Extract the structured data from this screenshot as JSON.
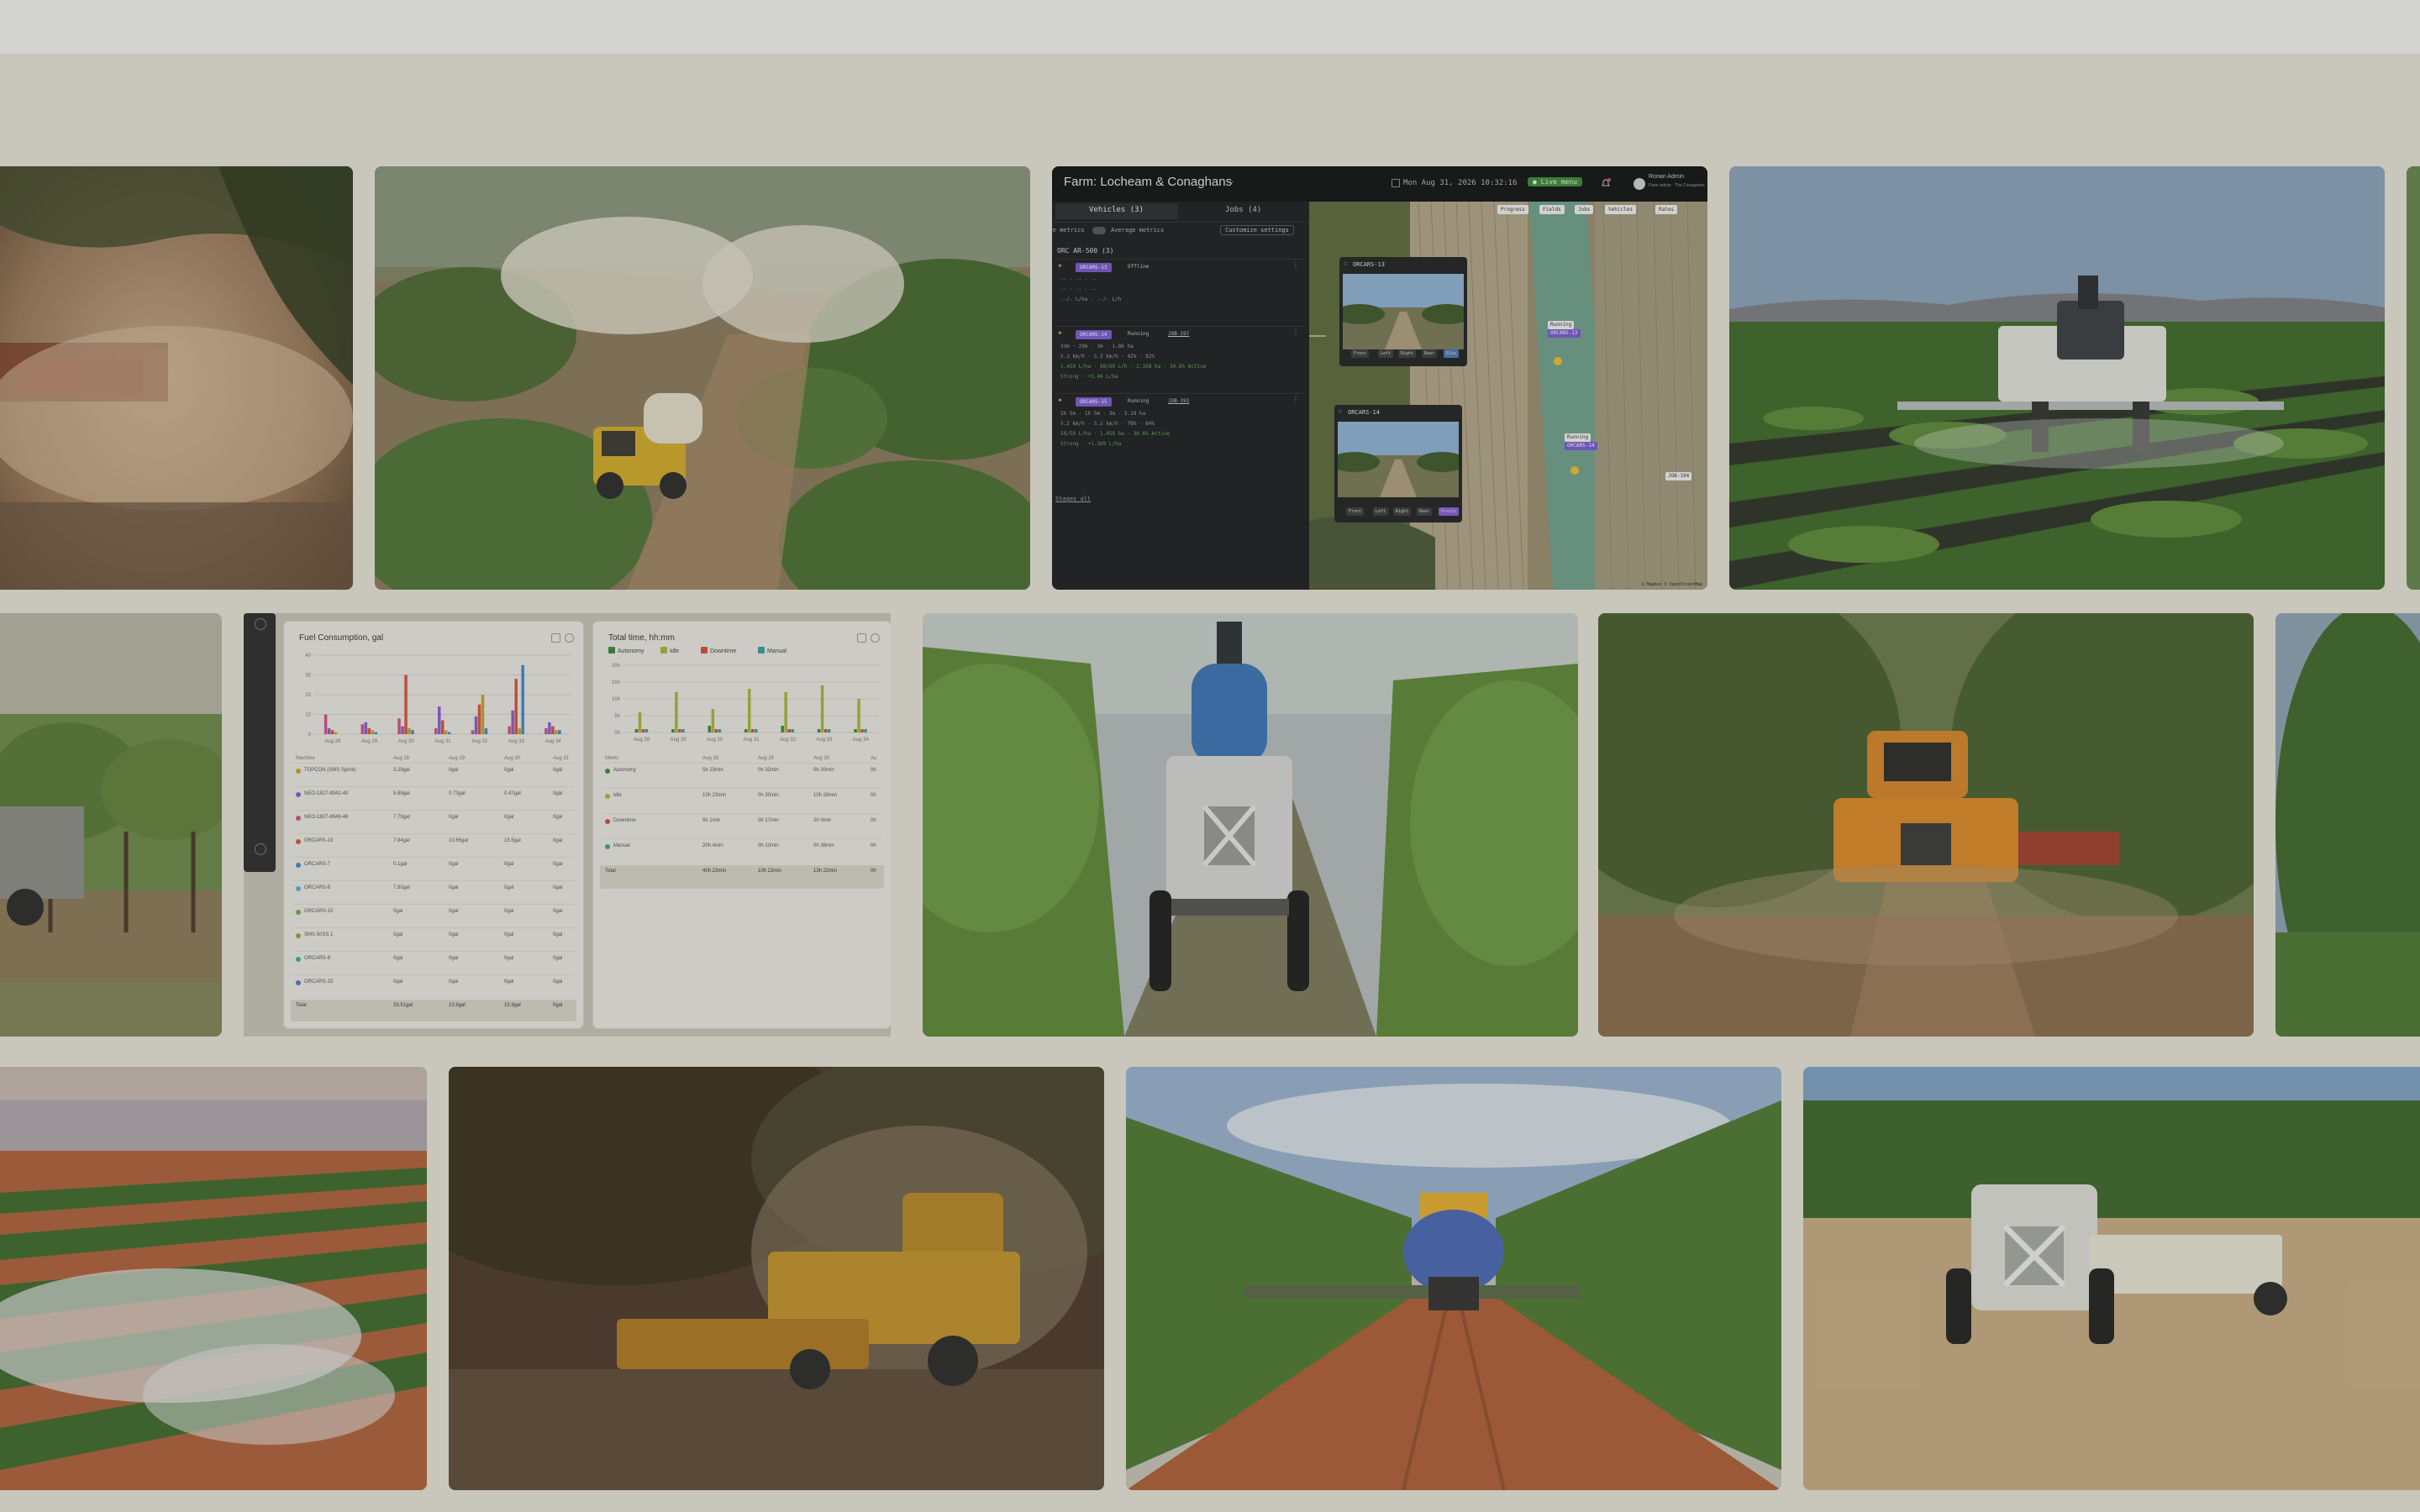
{
  "dashboard": {
    "farm_title": "Farm: Locheam & Conaghans",
    "datetime": "Mon Aug 31, 2026 10:32:16",
    "live_label": "● Live menu",
    "user_name": "Ronan Admin",
    "user_sub": "Farm admin · The Conaghans",
    "tabs": [
      "Vehicles (3)",
      "Jobs (4)"
    ],
    "live_metrics_label": "Live metrics",
    "average_metrics_label": "Average metrics",
    "customize_label": "Customize settings",
    "group_label": "ORC AR-500 (3)",
    "vehicles": [
      {
        "id": "ORCARS-13",
        "status": "Offline",
        "job": "",
        "l1": "-- · -- · --",
        "l2": "-- · -- · --",
        "l3": "--/- L/ha · --/- L/h",
        "l4": ""
      },
      {
        "id": "ORCARS-14",
        "status": "Running",
        "job": "JOB-197",
        "l1": "33m · 29m · 3m · 1.86 ha",
        "l2": "5.3 km/h · 5.3 km/h · 42% · 82%",
        "l3": "1.450 L/ha · 68/60 L/h · 2.358 ha · 30.6% Active",
        "l4": "Strong · +3.46 L/ha"
      },
      {
        "id": "ORCARS-15",
        "status": "Running",
        "job": "JOB-193",
        "l1": "1h 5m · 1h 5m · 3m · 3.19 ha",
        "l2": "5.2 km/h · 5.2 km/h · 78% · 84%",
        "l3": "58/58 L/ha · 1.459 ha · 30.6% Active",
        "l4": "Strong · +1.369 L/ha"
      }
    ],
    "link_label": "Stages all",
    "map_pills": [
      "Progress",
      "Fields",
      "Jobs",
      "Vehicles",
      "Rates"
    ],
    "cams": [
      {
        "title": "ORCARS-13",
        "buttons": [
          "Front",
          "Left",
          "Right",
          "Rear",
          "Blue"
        ]
      },
      {
        "title": "ORCARS-14",
        "buttons": [
          "Front",
          "Left",
          "Right",
          "Rear",
          "Purple"
        ]
      }
    ],
    "map_tags": [
      "Running",
      "ORCARS-13",
      "Running",
      "ORCARS-14",
      "JOB-194"
    ],
    "map_credit": "© Mapbox © OpenStreetMap"
  },
  "reports": {
    "fuel": {
      "title": "Fuel Consumption, gal",
      "y_ticks": [
        "40",
        "30",
        "20",
        "10",
        "0"
      ],
      "x_ticks": [
        "Aug 28",
        "Aug 29",
        "Aug 30",
        "Aug 31",
        "Aug 32",
        "Aug 33",
        "Aug 34"
      ],
      "columns": [
        "Machine",
        "Aug 28",
        "Aug 29",
        "Aug 30",
        "Aug 31"
      ],
      "rows": [
        {
          "name": "TOPCON (SMS Sprint)",
          "cells": [
            "3.29gal",
            "0gal",
            "0gal",
            "0gal"
          ],
          "color": "#c9a227"
        },
        {
          "name": "NEO-1827-8942-40",
          "cells": [
            "5.89gal",
            "0.73gal",
            "0.47gal",
            "0gal"
          ],
          "color": "#8a5bd6"
        },
        {
          "name": "NEO-1827-8949-46",
          "cells": [
            "7.79gal",
            "0gal",
            "0gal",
            "0gal"
          ],
          "color": "#d64f8a"
        },
        {
          "name": "ORCARS-13",
          "cells": [
            "7.84gal",
            "10.65gal",
            "15.5gal",
            "0gal"
          ],
          "color": "#d6553c"
        },
        {
          "name": "ORCARS-7",
          "cells": [
            "0.1gal",
            "0gal",
            "0gal",
            "0gal"
          ],
          "color": "#3c8ad6"
        },
        {
          "name": "ORCARS-9",
          "cells": [
            "7.80gal",
            "0gal",
            "0gal",
            "0gal"
          ],
          "color": "#5bb0d6"
        },
        {
          "name": "ORCARS-10",
          "cells": [
            "0gal",
            "0gal",
            "0gal",
            "0gal"
          ],
          "color": "#6fb04a"
        },
        {
          "name": "SMS 50SS 1",
          "cells": [
            "0gal",
            "0gal",
            "0gal",
            "0gal"
          ],
          "color": "#a0a03c"
        },
        {
          "name": "ORCARS-8",
          "cells": [
            "0gal",
            "0gal",
            "0gal",
            "0gal"
          ],
          "color": "#3cb09a"
        },
        {
          "name": "ORCARS-15",
          "cells": [
            "0gal",
            "0gal",
            "0gal",
            "0gal"
          ],
          "color": "#5b6fd6"
        }
      ],
      "total": {
        "name": "Total",
        "cells": [
          "33.51gal",
          "10.9gal",
          "15.9gal",
          "0gal"
        ]
      }
    },
    "time": {
      "title": "Total time, hh:mm",
      "legend": [
        {
          "label": "Autonomy",
          "color": "#3c8a3a"
        },
        {
          "label": "Idle",
          "color": "#a6b83a"
        },
        {
          "label": "Downtime",
          "color": "#d64f3c"
        },
        {
          "label": "Manual",
          "color": "#3aa0a0"
        }
      ],
      "y_ticks": [
        "20h",
        "15h",
        "10h",
        "5h",
        "0h"
      ],
      "x_ticks": [
        "Aug 28",
        "Aug 29",
        "Aug 30",
        "Aug 31",
        "Aug 32",
        "Aug 33",
        "Aug 34"
      ],
      "columns": [
        "Metric",
        "Aug 28",
        "Aug 29",
        "Aug 30",
        "Au"
      ],
      "rows": [
        {
          "name": "Autonomy",
          "cells": [
            "5h 23min",
            "0h 32min",
            "0h 20min",
            "0h"
          ],
          "color": "#3c8a3a"
        },
        {
          "name": "Idle",
          "cells": [
            "10h 23min",
            "0h 30min",
            "10h 28min",
            "0h"
          ],
          "color": "#a6b83a"
        },
        {
          "name": "Downtime",
          "cells": [
            "5h 1min",
            "0h 17min",
            "2h 0min",
            "0h"
          ],
          "color": "#d64f3c"
        },
        {
          "name": "Manual",
          "cells": [
            "20h 4min",
            "0h 10min",
            "0h 38min",
            "0h"
          ],
          "color": "#3aa0a0"
        }
      ],
      "total": {
        "name": "Total",
        "cells": [
          "40h 23min",
          "10h 23min",
          "13h 22min",
          "0h"
        ]
      }
    }
  },
  "colors": {
    "background": "#c9c6bb",
    "dashboard_bg": "#1a1b1d",
    "accent_purple": "#7a5bd6",
    "live_green": "#3c8a3a"
  },
  "chart_data": [
    {
      "type": "bar",
      "title": "Fuel Consumption, gal",
      "categories": [
        "Aug 28",
        "Aug 29",
        "Aug 30",
        "Aug 31",
        "Aug 32",
        "Aug 33",
        "Aug 34"
      ],
      "series": [
        {
          "values": [
            10,
            5,
            8,
            3,
            2,
            4,
            3
          ],
          "color": "#d64f8a"
        },
        {
          "values": [
            3,
            6,
            4,
            14,
            9,
            12,
            6
          ],
          "color": "#8a5bd6"
        },
        {
          "values": [
            2,
            3,
            30,
            7,
            15,
            28,
            4
          ],
          "color": "#d6553c"
        },
        {
          "values": [
            1,
            2,
            3,
            2,
            20,
            3,
            2
          ],
          "color": "#c9a227"
        },
        {
          "values": [
            0,
            1,
            2,
            1,
            3,
            35,
            2
          ],
          "color": "#3c8ad6"
        }
      ],
      "ylim": [
        0,
        40
      ]
    },
    {
      "type": "bar",
      "title": "Total time, hh:mm",
      "categories": [
        "Aug 28",
        "Aug 29",
        "Aug 30",
        "Aug 31",
        "Aug 32",
        "Aug 33",
        "Aug 34"
      ],
      "series": [
        {
          "name": "Autonomy",
          "values": [
            1,
            1,
            2,
            1,
            2,
            1,
            1
          ],
          "color": "#3c8a3a"
        },
        {
          "name": "Idle",
          "values": [
            6,
            12,
            7,
            13,
            12,
            14,
            10
          ],
          "color": "#a6b83a"
        },
        {
          "name": "Downtime",
          "values": [
            1,
            1,
            1,
            1,
            1,
            1,
            1
          ],
          "color": "#d64f3c"
        },
        {
          "name": "Manual",
          "values": [
            1,
            1,
            1,
            1,
            1,
            1,
            1
          ],
          "color": "#3aa0a0"
        }
      ],
      "ylim": [
        0,
        20
      ]
    }
  ]
}
